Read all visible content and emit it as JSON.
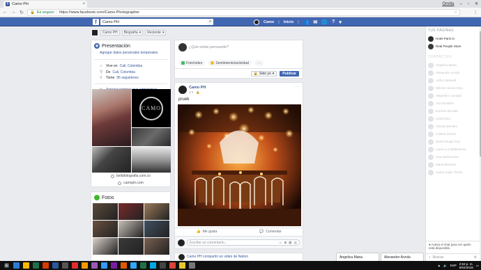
{
  "browser": {
    "tab_title": "Camo PH",
    "tab_close": "×",
    "user": "Omilla",
    "secure_label": "Es seguro",
    "url": "https://www.facebook.com/Camo.Photographer",
    "star": "☆"
  },
  "fb": {
    "logo": "f",
    "search_value": "Camo PH",
    "search_icon": "⌕",
    "user_name": "Camo",
    "home_label": "Inicio"
  },
  "subheader": {
    "page_name": "Camo PH",
    "biography": "Biografía",
    "recent": "Reciente"
  },
  "intro": {
    "title": "Presentación",
    "add_details": "Agregar datos personales temporales",
    "lives_prefix": "Vive en",
    "lives_city": "Cali, Colombia",
    "from_prefix": "De",
    "from_city": "Cali, Colombia",
    "followers_prefix": "Tiene",
    "followers": "95 seguidores",
    "add_pages": "Agregar páginas que administras",
    "gallery_logo": "CAMO",
    "link1": "bellafotografia.com.co",
    "link2": "camoph.com"
  },
  "photos": {
    "title": "Fotos",
    "colors": [
      "#5a4a3a",
      "#7a2a2a",
      "#9a7a5a",
      "#6a5040",
      "#c8c0b8",
      "#405060",
      "#d8d0c8",
      "#3a3a3a",
      "#7a6050"
    ]
  },
  "composer": {
    "placeholder": "¿Qué estás pensando?",
    "photo_video": "Foto/video",
    "feeling": "Sentimiento/actividad",
    "more": "···",
    "privacy": "Solo yo",
    "publish": "Publicar"
  },
  "post": {
    "author": "Camo PH",
    "time": "1 h · 🔒",
    "more": "···",
    "text": "prueb",
    "like": "Me gusta",
    "comment": "Comentar",
    "comment_placeholder": "Escribe un comentario..."
  },
  "post2": {
    "text": "Camo PH compartió un video de Nation"
  },
  "chat": {
    "pages_header": "TUS PÁGINAS",
    "pages": [
      {
        "name": "Hotel Paris In",
        "color": "#2a2a2a"
      },
      {
        "name": "Real People Store",
        "color": "#3a3a3a"
      }
    ],
    "contacts_header": "CONTACTOS",
    "contacts": [
      "Angelica Maria",
      "Alexander Arzola",
      "Arthur Mansell",
      "Wilmer Alonso Esp...",
      "Alejandro Carvajal",
      "Yoni Rosales",
      "Everton Bocalet",
      "Linda Rico",
      "Viviana Benitez",
      "Juliana García",
      "Daniel Rojas Pinz",
      "Laura Luz Ballesteros",
      "Lina Maria Nova",
      "Maria Martinez",
      "Juana Luján Torres"
    ],
    "footer": "Activa el chat para ver quién está disponible.",
    "search": "Buscar"
  },
  "docked": {
    "tab1": "Angelica Maria",
    "tab2": "Alexander Arzola"
  },
  "taskbar": {
    "lang": "ESP",
    "time": "2:53 p. m.",
    "date": "9/04/2018",
    "icon_colors": [
      "#2b7cd3",
      "#ffb900",
      "#1e7145",
      "#d83b01",
      "#2b579a",
      "#555",
      "#e02c2c",
      "#ff9a00",
      "#9b59b6",
      "#3399ff",
      "#7a1fa2",
      "#e05a00",
      "#31a8ff",
      "#1e7145",
      "#00a8e8",
      "#444",
      "#db4437",
      "#e8c830",
      "#777"
    ]
  }
}
